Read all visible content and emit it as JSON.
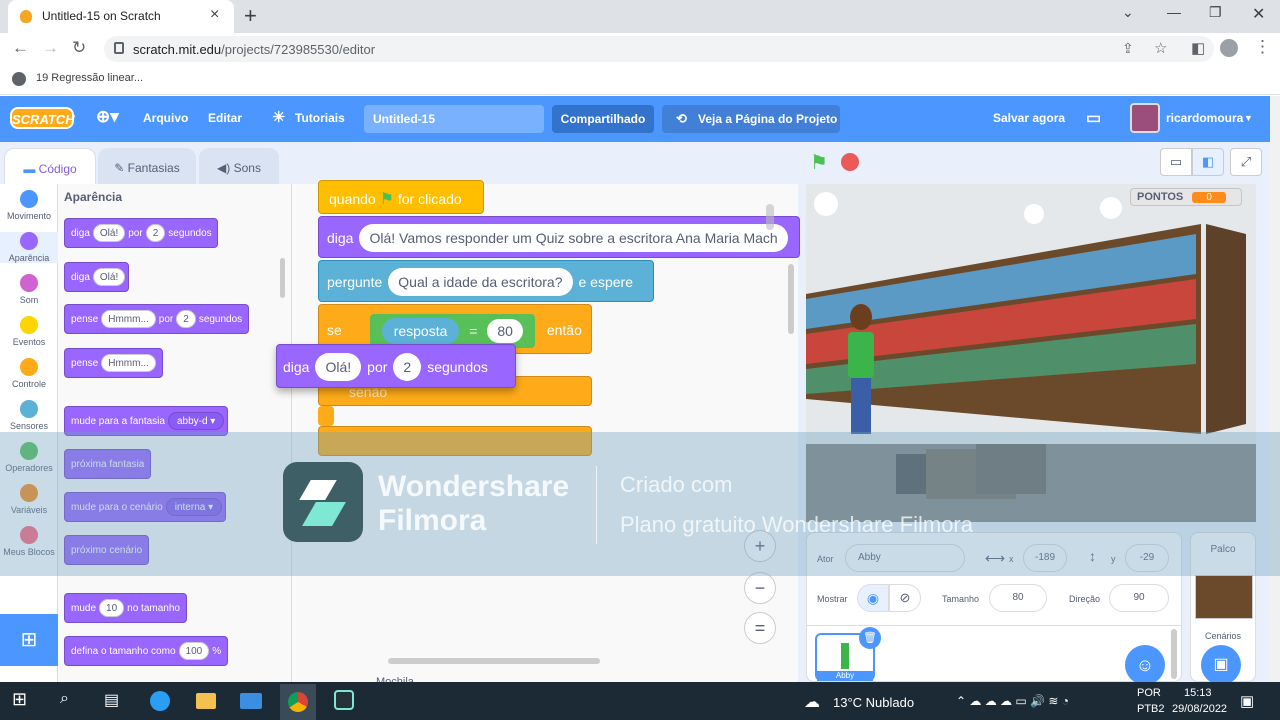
{
  "browser": {
    "tab_title": "Untitled-15 on Scratch",
    "new_tab": "+",
    "url_host": "scratch.mit.edu",
    "url_path": "/projects/723985530/editor",
    "bookmark": "19 Regressão linear..."
  },
  "menu": {
    "logo": "SCRATCH",
    "file": "Arquivo",
    "edit": "Editar",
    "tutorials": "Tutoriais",
    "project_title": "Untitled-15",
    "share": "Compartilhado",
    "see_project": "Veja a Página do Projeto",
    "save_now": "Salvar agora",
    "username": "ricardomoura"
  },
  "tabs": {
    "code": "Código",
    "costumes": "Fantasias",
    "sounds": "Sons"
  },
  "categories": [
    {
      "label": "Movimento",
      "color": "#4c97ff"
    },
    {
      "label": "Aparência",
      "color": "#9966ff"
    },
    {
      "label": "Som",
      "color": "#cf63cf"
    },
    {
      "label": "Eventos",
      "color": "#ffd500"
    },
    {
      "label": "Controle",
      "color": "#ffab19"
    },
    {
      "label": "Sensores",
      "color": "#5cb1d6"
    },
    {
      "label": "Operadores",
      "color": "#59c059"
    },
    {
      "label": "Variáveis",
      "color": "#ff8c1a"
    },
    {
      "label": "Meus Blocos",
      "color": "#ff6680"
    }
  ],
  "palette": {
    "heading": "Aparência",
    "b1": {
      "a": "diga",
      "v1": "Olá!",
      "b": "por",
      "v2": "2",
      "c": "segundos"
    },
    "b2": {
      "a": "diga",
      "v1": "Olá!"
    },
    "b3": {
      "a": "pense",
      "v1": "Hmmm...",
      "b": "por",
      "v2": "2",
      "c": "segundos"
    },
    "b4": {
      "a": "pense",
      "v1": "Hmmm..."
    },
    "b5": {
      "a": "mude para a fantasia",
      "v1": "abby-d ▾"
    },
    "b6": "próxima fantasia",
    "b7": {
      "a": "mude para o cenário",
      "v1": "interna ▾"
    },
    "b8": "próximo cenário",
    "b9": {
      "a": "mude",
      "v1": "10",
      "b": "no tamanho"
    },
    "b10": {
      "a": "defina o tamanho como",
      "v1": "100",
      "b": "%"
    }
  },
  "script": {
    "hat": {
      "a": "quando",
      "b": "for clicado"
    },
    "say": {
      "a": "diga",
      "v": "Olá! Vamos responder um Quiz sobre a escritora Ana Maria Mach"
    },
    "ask": {
      "a": "pergunte",
      "v": "Qual a idade da escritora?",
      "b": "e espere"
    },
    "if": {
      "a": "se",
      "var": "resposta",
      "op": "=",
      "val": "80",
      "b": "então"
    },
    "else": "senão",
    "drag": {
      "a": "diga",
      "v1": "Olá!",
      "b": "por",
      "v2": "2",
      "c": "segundos"
    },
    "sprite_label": "Abby"
  },
  "stage": {
    "score_label": "PONTOS",
    "score_value": "0"
  },
  "sprite_info": {
    "actor_label": "Ator",
    "actor_name": "Abby",
    "x_label": "x",
    "x": "-189",
    "y_label": "y",
    "y": "-29",
    "show_label": "Mostrar",
    "size_label": "Tamanho",
    "size": "80",
    "direction_label": "Direção",
    "direction": "90",
    "sprite_thumb_label": "Abby"
  },
  "stage_panel": {
    "title": "Palco",
    "backdrops": "Cenários"
  },
  "watermark": {
    "brand1": "Wondershare",
    "brand2": "Filmora",
    "made": "Criado com",
    "plan": "Plano gratuito Wondershare Filmora"
  },
  "taskbar": {
    "weather": "13°C  Nublado",
    "lang1": "POR",
    "lang2": "PTB2",
    "time": "15:13",
    "date": "29/08/2022"
  },
  "zoom": {
    "in": "+",
    "out": "−",
    "reset": "="
  },
  "bottom_label": "Mochila"
}
